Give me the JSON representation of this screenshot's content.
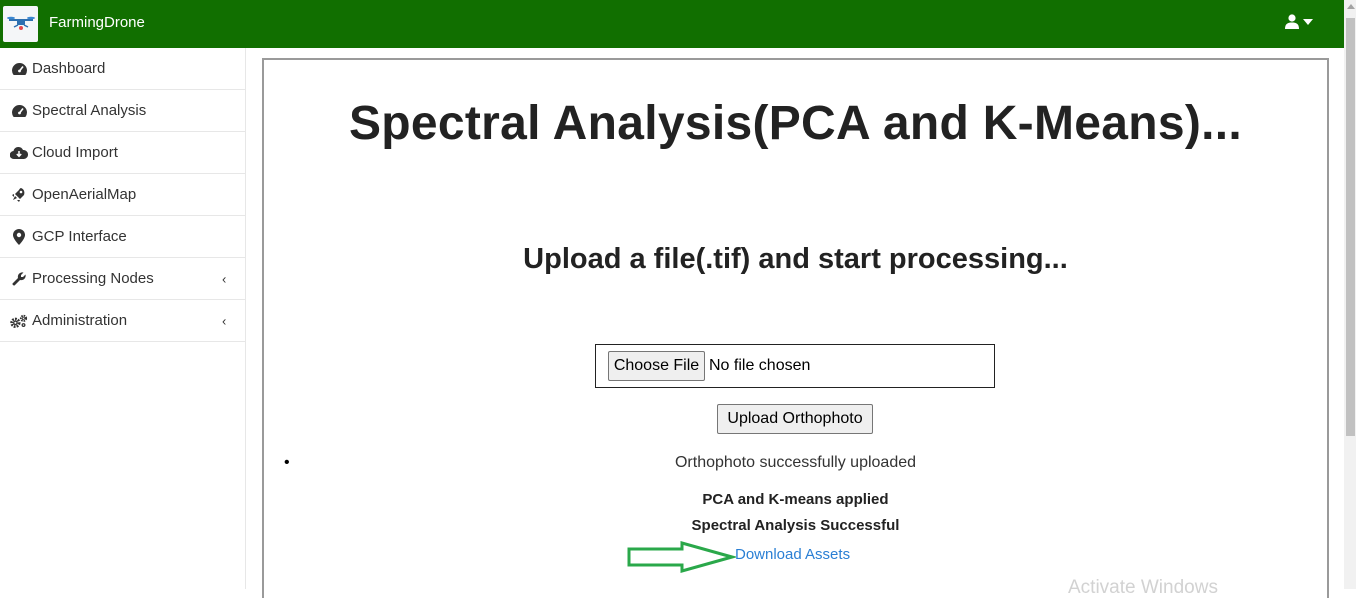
{
  "app": {
    "brand_name": "FarmingDrone",
    "header_color": "#116f00"
  },
  "header": {
    "user_icon": "user-icon",
    "dropdown_icon": "caret-down-icon"
  },
  "sidebar": {
    "items": [
      {
        "label": "Dashboard",
        "icon": "tachometer-icon"
      },
      {
        "label": "Spectral Analysis",
        "icon": "tachometer-icon"
      },
      {
        "label": "Cloud Import",
        "icon": "cloud-download-icon"
      },
      {
        "label": "OpenAerialMap",
        "icon": "rocket-icon"
      },
      {
        "label": "GCP Interface",
        "icon": "map-marker-icon"
      },
      {
        "label": "Processing Nodes",
        "icon": "wrench-icon",
        "caret": "‹"
      },
      {
        "label": "Administration",
        "icon": "gears-icon",
        "caret": "‹"
      }
    ]
  },
  "main": {
    "title": "Spectral Analysis(PCA and K-Means)...",
    "subtitle": "Upload a file(.tif) and start processing...",
    "file_input": {
      "button_label": "Choose File",
      "status": "No file chosen"
    },
    "upload_button": "Upload Orthophoto",
    "messages": {
      "uploaded": "Orthophoto successfully uploaded",
      "pca": "PCA and K-means applied",
      "spectral": "Spectral Analysis Successful"
    },
    "download_link": "Download Assets",
    "annotation_arrow_color": "#2aa84a",
    "link_color": "#2a7fd4"
  },
  "overlay": {
    "watermark": "Activate Windows"
  }
}
